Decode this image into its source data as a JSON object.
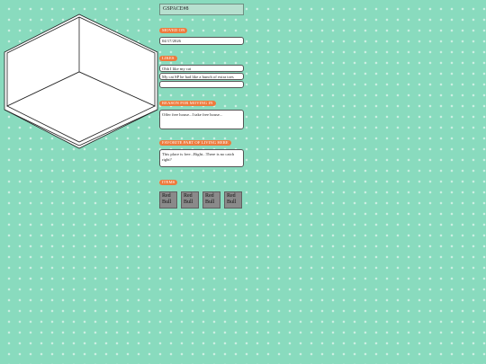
{
  "profile": {
    "title": "GSPACE#8",
    "moved_on_label": "MOVED ON",
    "moved_on_value": "04/17/2026",
    "likes_label": "LIKES",
    "likes": [
      "Ohh I like my cat",
      "My cat SP he had like a bunch of extra toes",
      ""
    ],
    "reason_label": "REASON FOR MOVING IN",
    "reason_value": "Offer free house...I take free house...",
    "favorite_label": "FAVORITE PART OF LIVING HERE",
    "favorite_value": "This place is free...Right...There is no catch right?",
    "items_label": "ITEMS",
    "items": [
      "Red Bull",
      "Red Bull",
      "Red Bull",
      "Red Bull"
    ]
  }
}
